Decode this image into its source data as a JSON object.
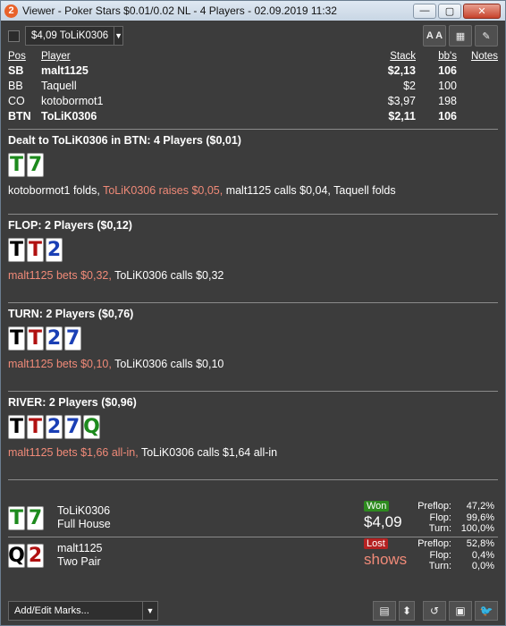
{
  "window": {
    "title": "Viewer - Poker Stars $0.01/0.02 NL - 4 Players - 02.09.2019 11:32",
    "app_badge": "2",
    "minimize": "—",
    "maximize": "▢",
    "close": "✕"
  },
  "toolbar": {
    "hand_select": "$4,09 ToLiK0306",
    "font_button": "A A",
    "grid_button": "▦",
    "edit_button": "✎"
  },
  "players_table": {
    "headers": {
      "pos": "Pos",
      "player": "Player",
      "stack": "Stack",
      "bbs": "bb's",
      "notes": "Notes"
    },
    "rows": [
      {
        "pos": "SB",
        "player": "malt1125",
        "stack": "$2,13",
        "bbs": "106"
      },
      {
        "pos": "BB",
        "player": "Taquell",
        "stack": "$2",
        "bbs": "100"
      },
      {
        "pos": "CO",
        "player": "kotobormot1",
        "stack": "$3,97",
        "bbs": "198"
      },
      {
        "pos": "BTN",
        "player": "ToLiK0306",
        "stack": "$2,11",
        "bbs": "106"
      }
    ]
  },
  "preflop": {
    "header": "Dealt to ToLiK0306 in BTN: 4 Players ($0,01)",
    "cards": [
      {
        "rank": "T",
        "color": "#1d8a1d"
      },
      {
        "rank": "7",
        "color": "#1d8a1d"
      }
    ],
    "actions": [
      {
        "text": "kotobormot1 folds, ",
        "hl": false
      },
      {
        "text": "ToLiK0306 raises $0,05, ",
        "hl": true
      },
      {
        "text": "malt1125 calls $0,04, Taquell folds",
        "hl": false
      }
    ]
  },
  "flop": {
    "header": "FLOP: 2 Players ($0,12)",
    "cards": [
      {
        "rank": "T",
        "color": "#000000"
      },
      {
        "rank": "T",
        "color": "#b01010"
      },
      {
        "rank": "2",
        "color": "#1a3fb5"
      }
    ],
    "actions": [
      {
        "text": "malt1125 bets $0,32, ",
        "hl": true
      },
      {
        "text": "ToLiK0306 calls $0,32",
        "hl": false
      }
    ]
  },
  "turn": {
    "header": "TURN: 2 Players ($0,76)",
    "cards": [
      {
        "rank": "T",
        "color": "#000000"
      },
      {
        "rank": "T",
        "color": "#b01010"
      },
      {
        "rank": "2",
        "color": "#1a3fb5"
      },
      {
        "rank": "7",
        "color": "#1a3fb5"
      }
    ],
    "actions": [
      {
        "text": "malt1125 bets $0,10, ",
        "hl": true
      },
      {
        "text": "ToLiK0306 calls $0,10",
        "hl": false
      }
    ]
  },
  "river": {
    "header": "RIVER: 2 Players ($0,96)",
    "cards": [
      {
        "rank": "T",
        "color": "#000000"
      },
      {
        "rank": "T",
        "color": "#b01010"
      },
      {
        "rank": "2",
        "color": "#1a3fb5"
      },
      {
        "rank": "7",
        "color": "#1a3fb5"
      },
      {
        "rank": "Q",
        "color": "#1d8a1d"
      }
    ],
    "actions": [
      {
        "text": "malt1125 bets $1,66 all-in, ",
        "hl": true
      },
      {
        "text": "ToLiK0306 calls $1,64 all-in",
        "hl": false
      }
    ]
  },
  "results": [
    {
      "cards": [
        {
          "rank": "T",
          "color": "#1d8a1d"
        },
        {
          "rank": "7",
          "color": "#1d8a1d"
        }
      ],
      "player": "ToLiK0306",
      "hand": "Full House",
      "badge": "Won",
      "amount": "$4,09",
      "equity": [
        {
          "label": "Preflop:",
          "value": "47,2%"
        },
        {
          "label": "Flop:",
          "value": "99,6%"
        },
        {
          "label": "Turn:",
          "value": "100,0%"
        }
      ]
    },
    {
      "cards": [
        {
          "rank": "Q",
          "color": "#000000"
        },
        {
          "rank": "2",
          "color": "#b01010"
        }
      ],
      "player": "malt1125",
      "hand": "Two Pair",
      "badge": "Lost",
      "amount": "shows",
      "equity": [
        {
          "label": "Preflop:",
          "value": "52,8%"
        },
        {
          "label": "Flop:",
          "value": "0,4%"
        },
        {
          "label": "Turn:",
          "value": "0,0%"
        }
      ]
    }
  ],
  "bottombar": {
    "marks_select": "Add/Edit Marks...",
    "calendar_button": "▤",
    "updown_button": "⬍",
    "replay_button": "↺",
    "save_button": "▣",
    "twitter_button": "🐦"
  }
}
